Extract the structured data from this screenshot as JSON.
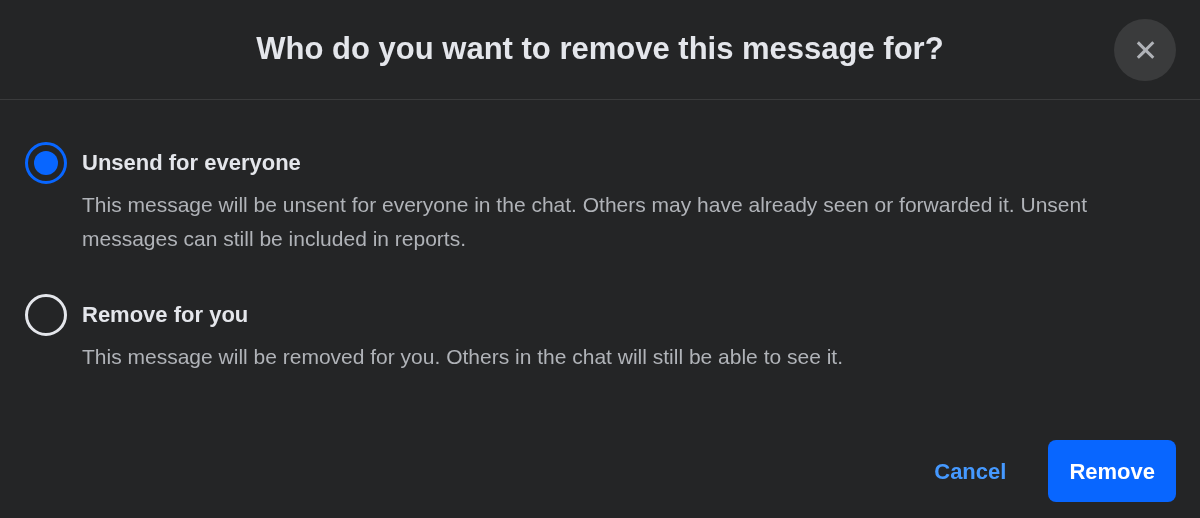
{
  "dialog": {
    "title": "Who do you want to remove this message for?",
    "close_label": "✕"
  },
  "options": [
    {
      "label": "Unsend for everyone",
      "description": "This message will be unsent for everyone in the chat. Others may have already seen or forwarded it. Unsent messages can still be included in reports.",
      "selected": true
    },
    {
      "label": "Remove for you",
      "description": "This message will be removed for you. Others in the chat will still be able to see it.",
      "selected": false
    }
  ],
  "buttons": {
    "cancel": "Cancel",
    "confirm": "Remove"
  }
}
